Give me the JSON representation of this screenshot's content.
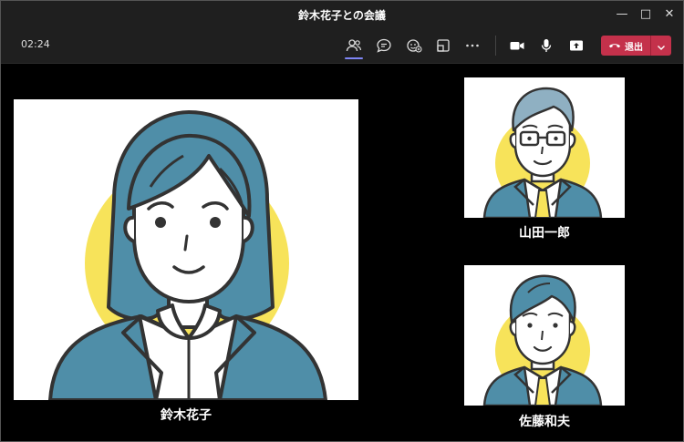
{
  "window": {
    "title": "鈴木花子との会議"
  },
  "toolbar": {
    "timer": "02:24",
    "leave_label": "退出"
  },
  "participants": [
    {
      "name": "鈴木花子"
    },
    {
      "name": "山田一郎"
    },
    {
      "name": "佐藤和夫"
    }
  ],
  "colors": {
    "leave_button": "#c4314b",
    "active_indicator": "#7f85f5",
    "avatar_circle": "#f7e35a",
    "suit": "#4f8ea8",
    "hair": "#4f8ea8",
    "tie": "#f7e35a"
  },
  "icons": [
    "participants-icon",
    "chat-icon",
    "reactions-icon",
    "view-icon",
    "more-icon",
    "camera-icon",
    "mic-icon",
    "share-icon",
    "phone-icon",
    "chevron-down-icon"
  ]
}
